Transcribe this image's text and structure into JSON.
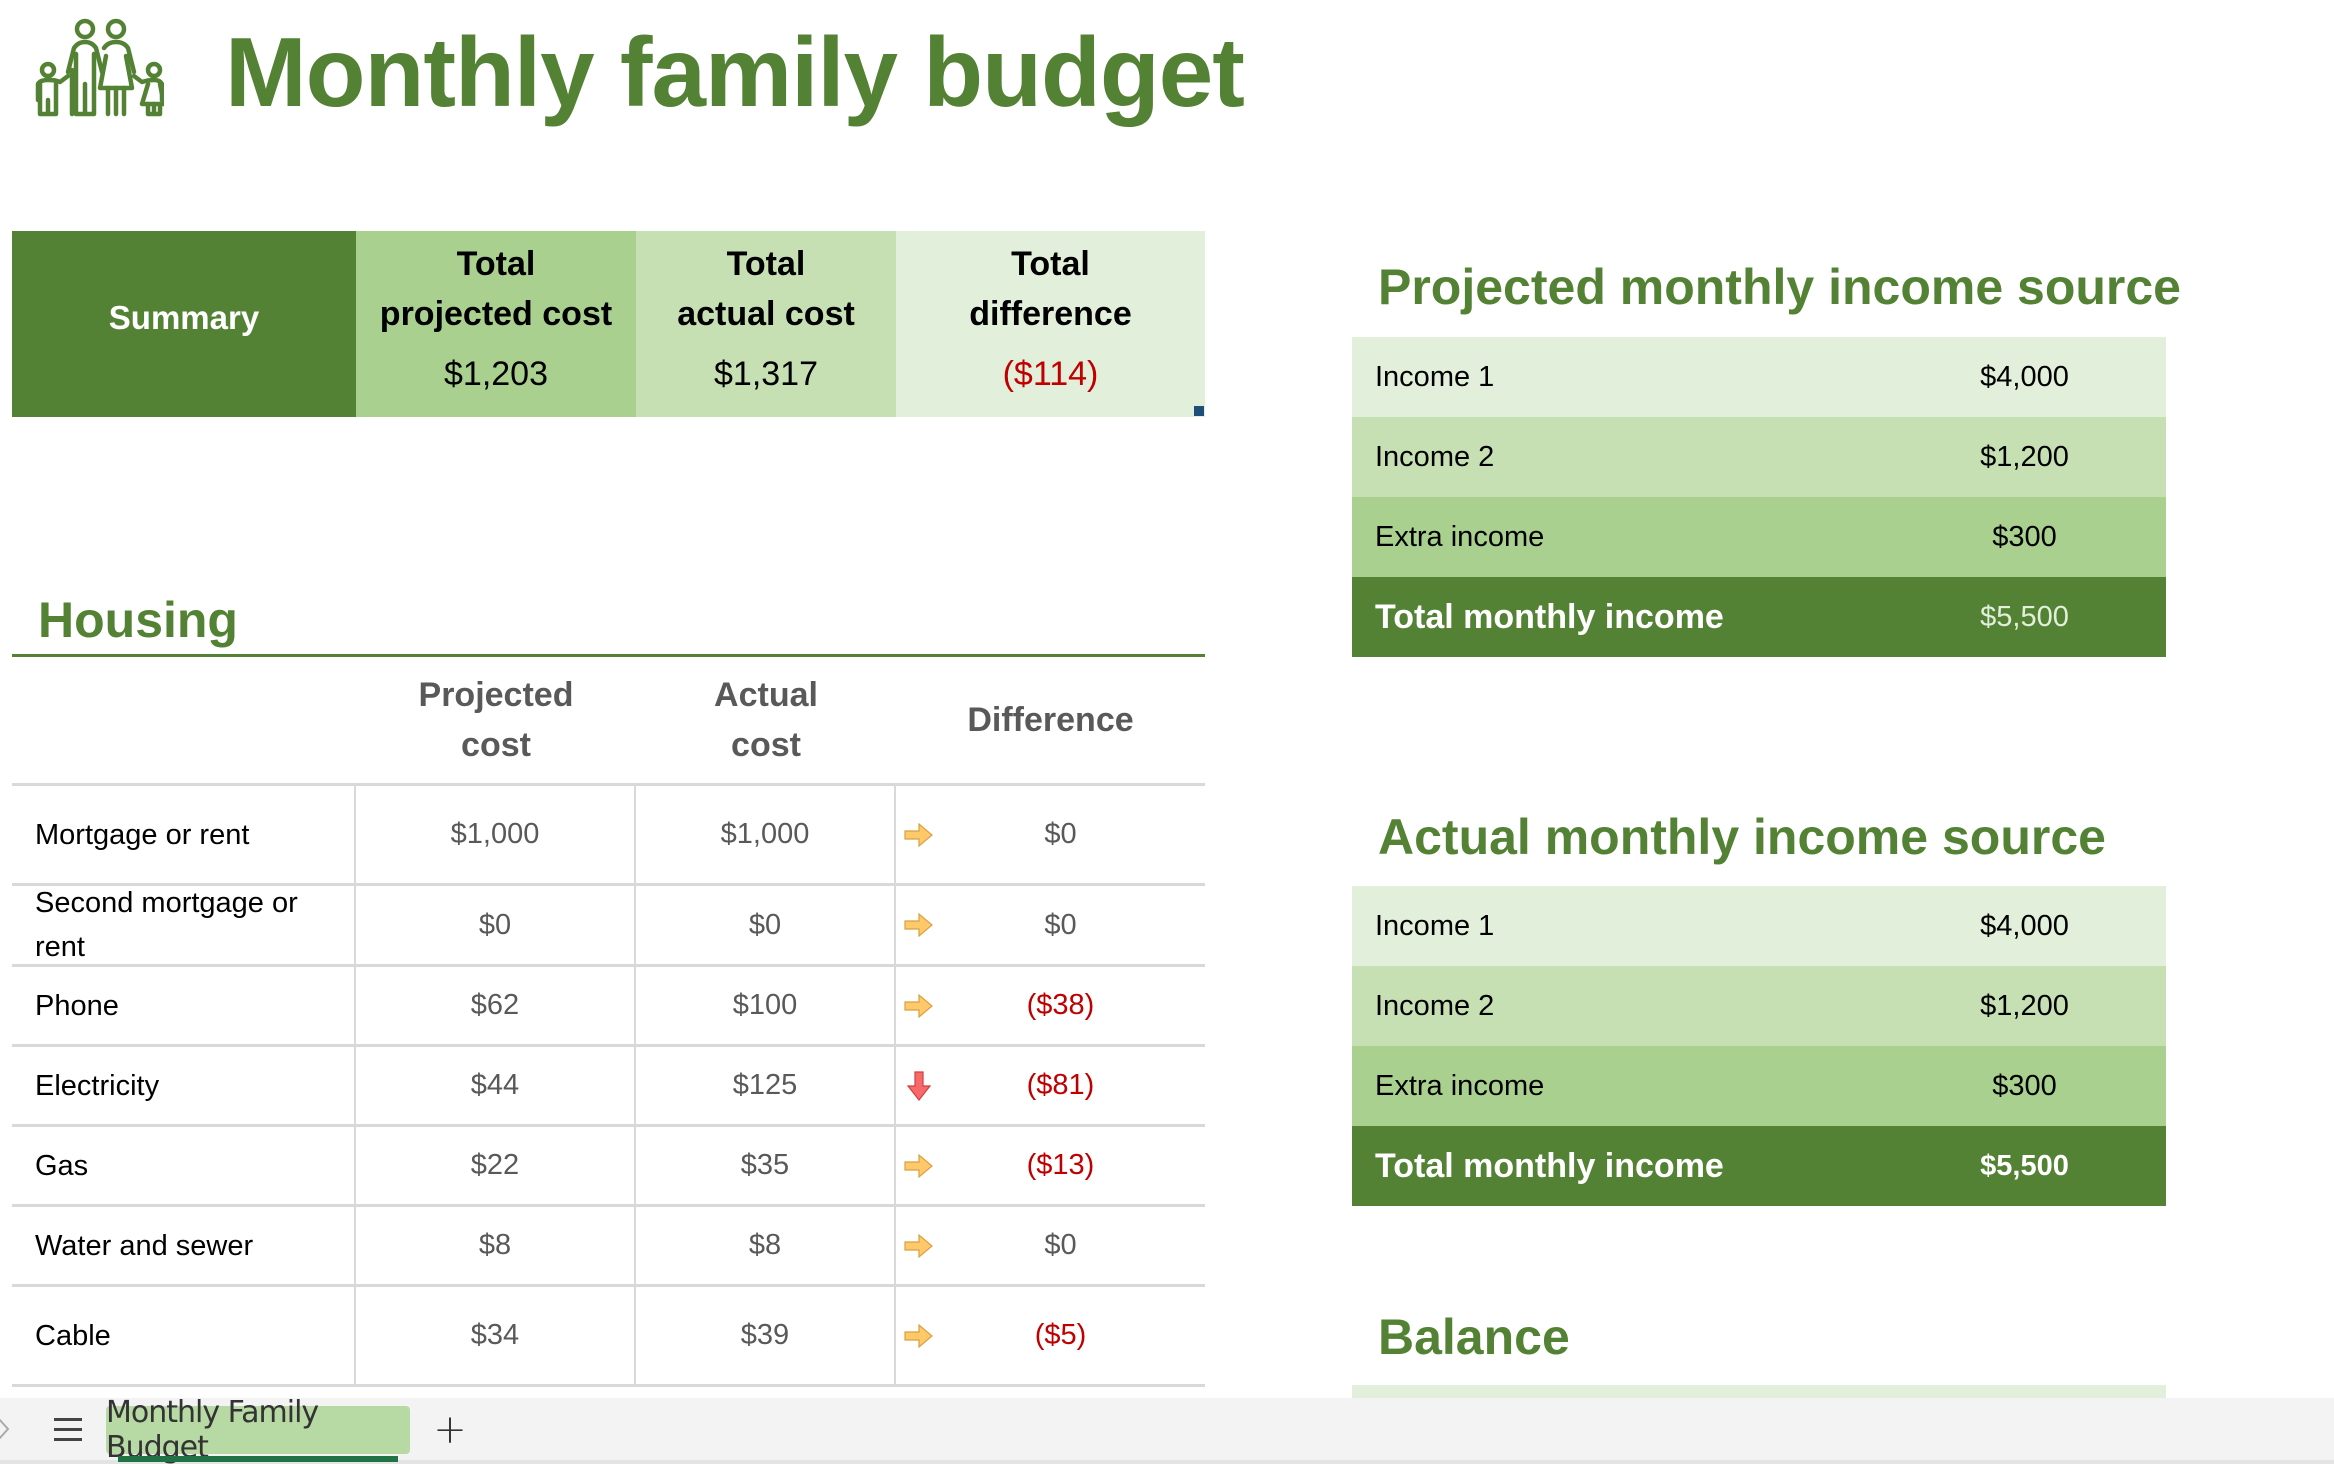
{
  "title": "Monthly family budget",
  "summary": {
    "label": "Summary",
    "columns": [
      {
        "header_line1": "Total",
        "header_line2": "projected cost",
        "value": "$1,203",
        "negative": false
      },
      {
        "header_line1": "Total",
        "header_line2": "actual cost",
        "value": "$1,317",
        "negative": false
      },
      {
        "header_line1": "Total",
        "header_line2": "difference",
        "value": "($114)",
        "negative": true
      }
    ]
  },
  "housing": {
    "title": "Housing",
    "headers": {
      "projected_line1": "Projected",
      "projected_line2": "cost",
      "actual_line1": "Actual",
      "actual_line2": "cost",
      "difference": "Difference"
    },
    "rows": [
      {
        "item": "Mortgage or rent",
        "projected": "$1,000",
        "actual": "$1,000",
        "difference": "$0",
        "trend": "right-arrow",
        "negative": false
      },
      {
        "item": "Second mortgage or rent",
        "projected": "$0",
        "actual": "$0",
        "difference": "$0",
        "trend": "right-arrow",
        "negative": false
      },
      {
        "item": "Phone",
        "projected": "$62",
        "actual": "$100",
        "difference": "($38)",
        "trend": "right-arrow",
        "negative": true
      },
      {
        "item": "Electricity",
        "projected": "$44",
        "actual": "$125",
        "difference": "($81)",
        "trend": "down-arrow",
        "negative": true
      },
      {
        "item": "Gas",
        "projected": "$22",
        "actual": "$35",
        "difference": "($13)",
        "trend": "right-arrow",
        "negative": true
      },
      {
        "item": "Water and sewer",
        "projected": "$8",
        "actual": "$8",
        "difference": "$0",
        "trend": "right-arrow",
        "negative": false
      },
      {
        "item": "Cable",
        "projected": "$34",
        "actual": "$39",
        "difference": "($5)",
        "trend": "right-arrow",
        "negative": true
      }
    ]
  },
  "projected_income": {
    "title": "Projected monthly income source",
    "rows": [
      {
        "label": "Income 1",
        "value": "$4,000"
      },
      {
        "label": "Income 2",
        "value": "$1,200"
      },
      {
        "label": "Extra income",
        "value": "$300"
      }
    ],
    "total_label": "Total monthly income",
    "total_value": "$5,500"
  },
  "actual_income": {
    "title": "Actual monthly income source",
    "rows": [
      {
        "label": "Income 1",
        "value": "$4,000"
      },
      {
        "label": "Income 2",
        "value": "$1,200"
      },
      {
        "label": "Extra income",
        "value": "$300"
      }
    ],
    "total_label": "Total monthly income",
    "total_value": "$5,500"
  },
  "balance": {
    "title": "Balance"
  },
  "sheet_tabs": {
    "active": "Monthly Family Budget",
    "add_label": "+"
  },
  "colors": {
    "brand_green": "#548235",
    "green_light": "#e2efda",
    "green_mid": "#c6e0b4",
    "green_strong": "#a9d08e",
    "negative_red": "#c00000",
    "arrow_neutral": "#ffc869",
    "arrow_down": "#f8696b"
  }
}
